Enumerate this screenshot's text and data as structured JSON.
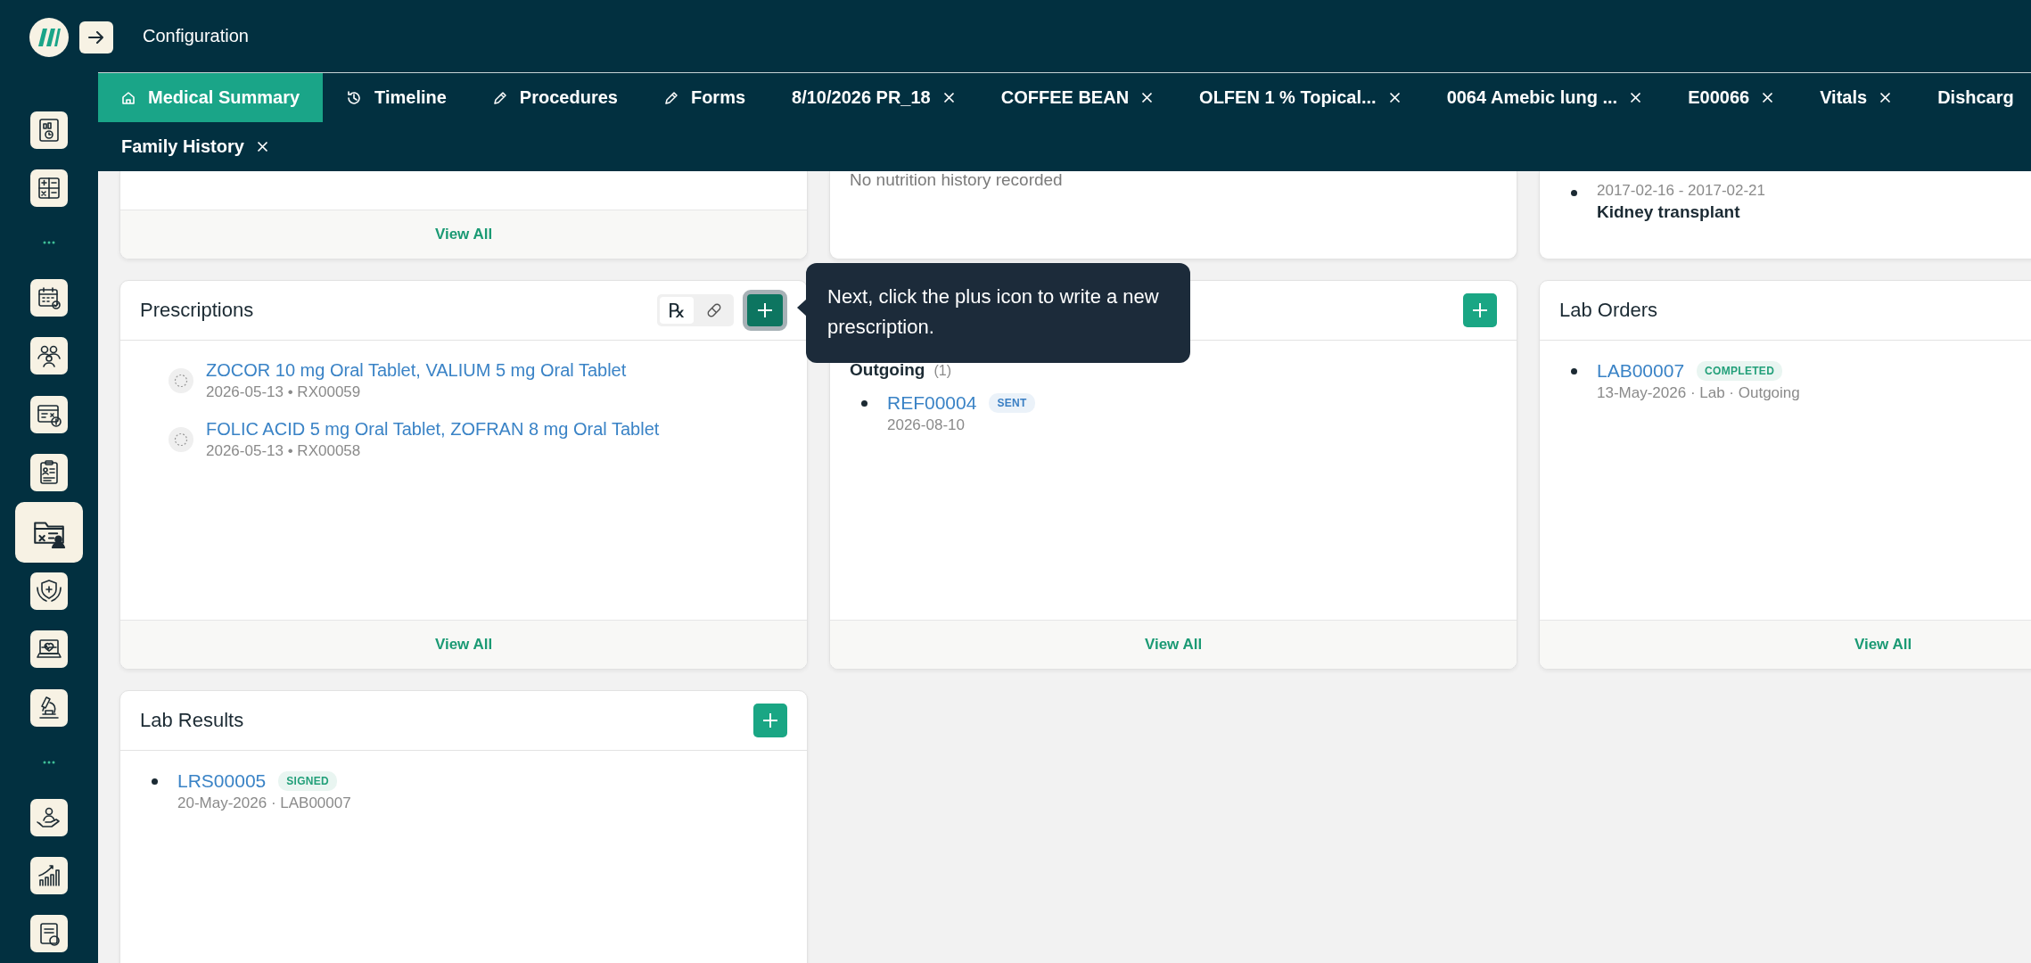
{
  "header": {
    "title": "Configuration"
  },
  "sidebar": {
    "items": [
      {
        "kind": "icon",
        "selected": false
      },
      {
        "kind": "icon",
        "selected": false
      },
      {
        "kind": "separator"
      },
      {
        "kind": "icon",
        "selected": false
      },
      {
        "kind": "icon",
        "selected": false
      },
      {
        "kind": "icon",
        "selected": false
      },
      {
        "kind": "icon",
        "selected": false
      },
      {
        "kind": "icon",
        "selected": true
      },
      {
        "kind": "icon",
        "selected": false
      },
      {
        "kind": "icon",
        "selected": false
      },
      {
        "kind": "icon",
        "selected": false
      },
      {
        "kind": "separator"
      },
      {
        "kind": "icon",
        "selected": false
      },
      {
        "kind": "icon",
        "selected": false
      },
      {
        "kind": "icon",
        "selected": false
      }
    ]
  },
  "tabs": [
    [
      {
        "label": "Medical Summary",
        "kind": "pinned",
        "selected": true
      },
      {
        "label": "Timeline",
        "kind": "pinned",
        "selected": false
      },
      {
        "label": "Procedures",
        "kind": "pinned",
        "selected": false
      },
      {
        "label": "Forms",
        "kind": "pinned",
        "selected": false
      },
      {
        "label": "8/10/2026 PR_18",
        "kind": "closable",
        "selected": false
      },
      {
        "label": "COFFEE BEAN",
        "kind": "closable",
        "selected": false
      },
      {
        "label": "OLFEN 1 % Topical...",
        "kind": "closable",
        "selected": false
      },
      {
        "label": "0064 Amebic lung ...",
        "kind": "closable",
        "selected": false
      },
      {
        "label": "E00066",
        "kind": "closable",
        "selected": false
      },
      {
        "label": "Vitals",
        "kind": "closable",
        "selected": false
      },
      {
        "label": "Dishcarg",
        "kind": "plain",
        "selected": false
      }
    ],
    [
      {
        "label": "Family History",
        "kind": "closable",
        "selected": false
      }
    ]
  ],
  "cards": [
    {
      "kind": "empty",
      "footer": "View All"
    },
    {
      "kind": "note",
      "text": "No nutrition history recorded"
    },
    {
      "kind": "history",
      "items": [
        {
          "dates": "2017-02-16 - 2017-02-21",
          "name": "Kidney transplant"
        }
      ]
    },
    {
      "kind": "prescriptions",
      "title": "Prescriptions",
      "toggle": [
        {
          "kind": "rx",
          "glyph": "℞",
          "selected": true
        },
        {
          "kind": "pill",
          "selected": false
        }
      ],
      "add_button": {
        "highlighted": true
      },
      "items": [
        {
          "name": "ZOCOR 10 mg Oral Tablet, VALIUM 5 mg Oral Tablet",
          "meta": "2026-05-13  •  RX00059"
        },
        {
          "name": "FOLIC ACID 5 mg Oral Tablet, ZOFRAN 8 mg Oral Tablet",
          "meta": "2026-05-13  •  RX00058"
        }
      ],
      "footer": "View All"
    },
    {
      "kind": "records",
      "add_button": {
        "highlighted": false
      },
      "group": {
        "label": "Outgoing",
        "count": "(1)"
      },
      "items": [
        {
          "id": "REF00004",
          "status": {
            "label": "SENT",
            "color": "#3a7fc4"
          },
          "meta": "2026-08-10"
        }
      ],
      "footer": "View All"
    },
    {
      "kind": "records",
      "title": "Lab Orders",
      "items": [
        {
          "id": "LAB00007",
          "status": {
            "label": "COMPLETED",
            "color": "#23a07a"
          },
          "meta": "13-May-2026  · Lab · Outgoing"
        }
      ],
      "footer": "View All"
    },
    {
      "kind": "records",
      "title": "Lab Results",
      "add_button": {
        "highlighted": false
      },
      "items": [
        {
          "id": "LRS00005",
          "status": {
            "label": "SIGNED",
            "color": "#23a07a"
          },
          "meta": "20-May-2026  · LAB00007"
        }
      ]
    }
  ],
  "tooltip": {
    "text": "Next, click the plus icon to write a new prescription."
  }
}
